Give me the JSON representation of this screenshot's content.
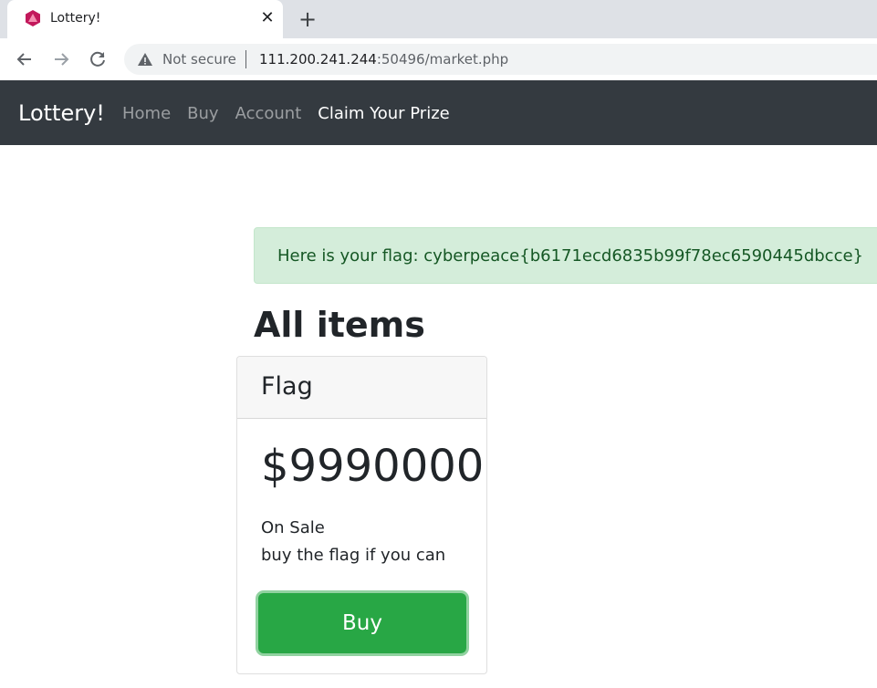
{
  "browser": {
    "tab_title": "Lottery!",
    "close_glyph": "✕",
    "new_tab_glyph": "+",
    "security_label": "Not secure",
    "url_host": "111.200.241.244",
    "url_rest": ":50496/market.php"
  },
  "navbar": {
    "brand": "Lottery!",
    "links": [
      "Home",
      "Buy",
      "Account",
      "Claim Your Prize"
    ]
  },
  "alert": {
    "text": "Here is your flag: cyberpeace{b6171ecd6835b99f78ec6590445dbcce}"
  },
  "main": {
    "heading": "All items"
  },
  "item": {
    "name": "Flag",
    "price": "$9990000",
    "status": "On Sale",
    "description": "buy the flag if you can",
    "buy_label": "Buy"
  },
  "colors": {
    "navbar_bg": "#343a40",
    "alert_bg": "#d4edda",
    "alert_text": "#155724",
    "buy_button": "#28a745"
  }
}
